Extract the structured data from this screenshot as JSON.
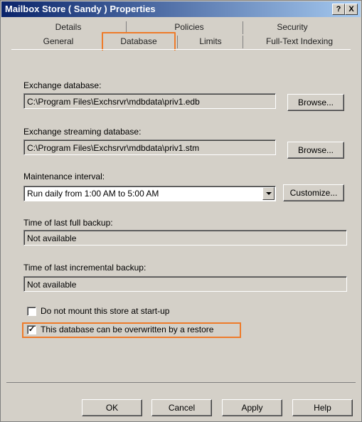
{
  "window": {
    "title": "Mailbox Store ( Sandy ) Properties",
    "help_btn": "?",
    "close_btn": "X"
  },
  "tabs": {
    "top": [
      "Details",
      "Policies",
      "Security"
    ],
    "bottom": [
      "General",
      "Database",
      "Limits",
      "Full-Text Indexing"
    ],
    "active": "Database"
  },
  "exchange_db": {
    "label": "Exchange database:",
    "value": "C:\\Program Files\\Exchsrvr\\mdbdata\\priv1.edb",
    "browse": "Browse..."
  },
  "streaming_db": {
    "label": "Exchange streaming database:",
    "value": "C:\\Program Files\\Exchsrvr\\mdbdata\\priv1.stm",
    "browse": "Browse..."
  },
  "maintenance": {
    "label": "Maintenance interval:",
    "value": "Run daily from 1:00 AM to 5:00 AM",
    "customize": "Customize..."
  },
  "full_backup": {
    "label": "Time of last full backup:",
    "value": "Not available"
  },
  "incremental_backup": {
    "label": "Time of last incremental backup:",
    "value": "Not available"
  },
  "options": {
    "no_mount": {
      "label": "Do not mount this store at start-up",
      "checked": false
    },
    "overwrite": {
      "label": "This database can be overwritten by a restore",
      "checked": true
    }
  },
  "buttons": {
    "ok": "OK",
    "cancel": "Cancel",
    "apply": "Apply",
    "help": "Help"
  },
  "colors": {
    "highlight": "#ee7b2a",
    "titlebar": "#0a246a",
    "dialog": "#d4d0c8"
  }
}
